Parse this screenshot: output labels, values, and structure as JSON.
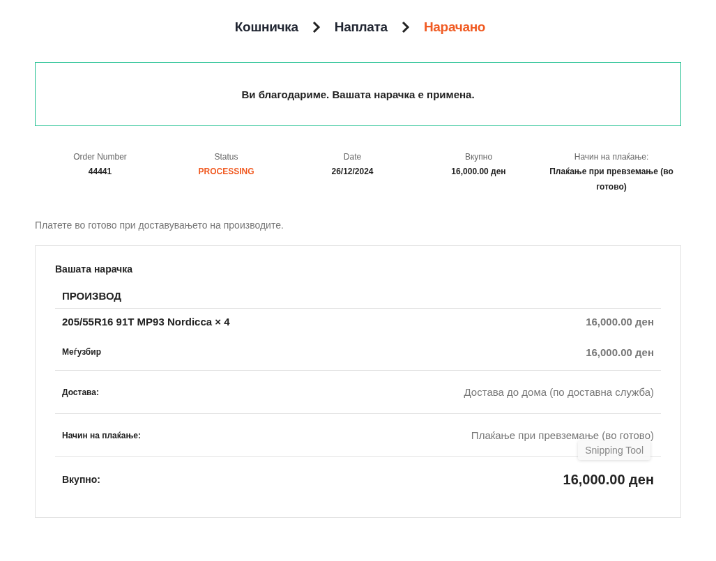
{
  "steps": [
    {
      "label": "Кошничка",
      "selected": false
    },
    {
      "label": "Наплата",
      "selected": false
    },
    {
      "label": "Нарачано",
      "selected": true
    }
  ],
  "notice": "Ви благодариме. Вашата нарачка е примена.",
  "overview": [
    {
      "label": "Order Number",
      "value": "44441",
      "kind": "plain"
    },
    {
      "label": "Status",
      "value": "PROCESSING",
      "kind": "status"
    },
    {
      "label": "Date",
      "value": "26/12/2024",
      "kind": "plain"
    },
    {
      "label": "Вкупно",
      "value": "16,000.00 ден",
      "kind": "plain"
    },
    {
      "label": "Начин на плаќање:",
      "value": "Плаќање при превземање (во готово)",
      "kind": "plain"
    }
  ],
  "payment_note": "Платете во готово при доставувањето на производите.",
  "order": {
    "title": "Вашата нарачка",
    "column": "ПРОИЗВОД",
    "items": [
      {
        "name": "205/55R16 91T MP93 Nordicca × 4",
        "price": "16,000.00 ден"
      }
    ],
    "totals": [
      {
        "label": "Меѓузбир",
        "value": "16,000.00 ден",
        "kind": "subtotal"
      },
      {
        "label": "Достава:",
        "value": "Достава до дома (по доставна служба)",
        "kind": "line"
      },
      {
        "label": "Начин на плаќање:",
        "value": "Плаќање при превземање (во готово)",
        "kind": "line"
      },
      {
        "label": "Вкупно:",
        "value": "16,000.00 ден",
        "kind": "total"
      }
    ]
  },
  "tooltip": "Snipping Tool"
}
